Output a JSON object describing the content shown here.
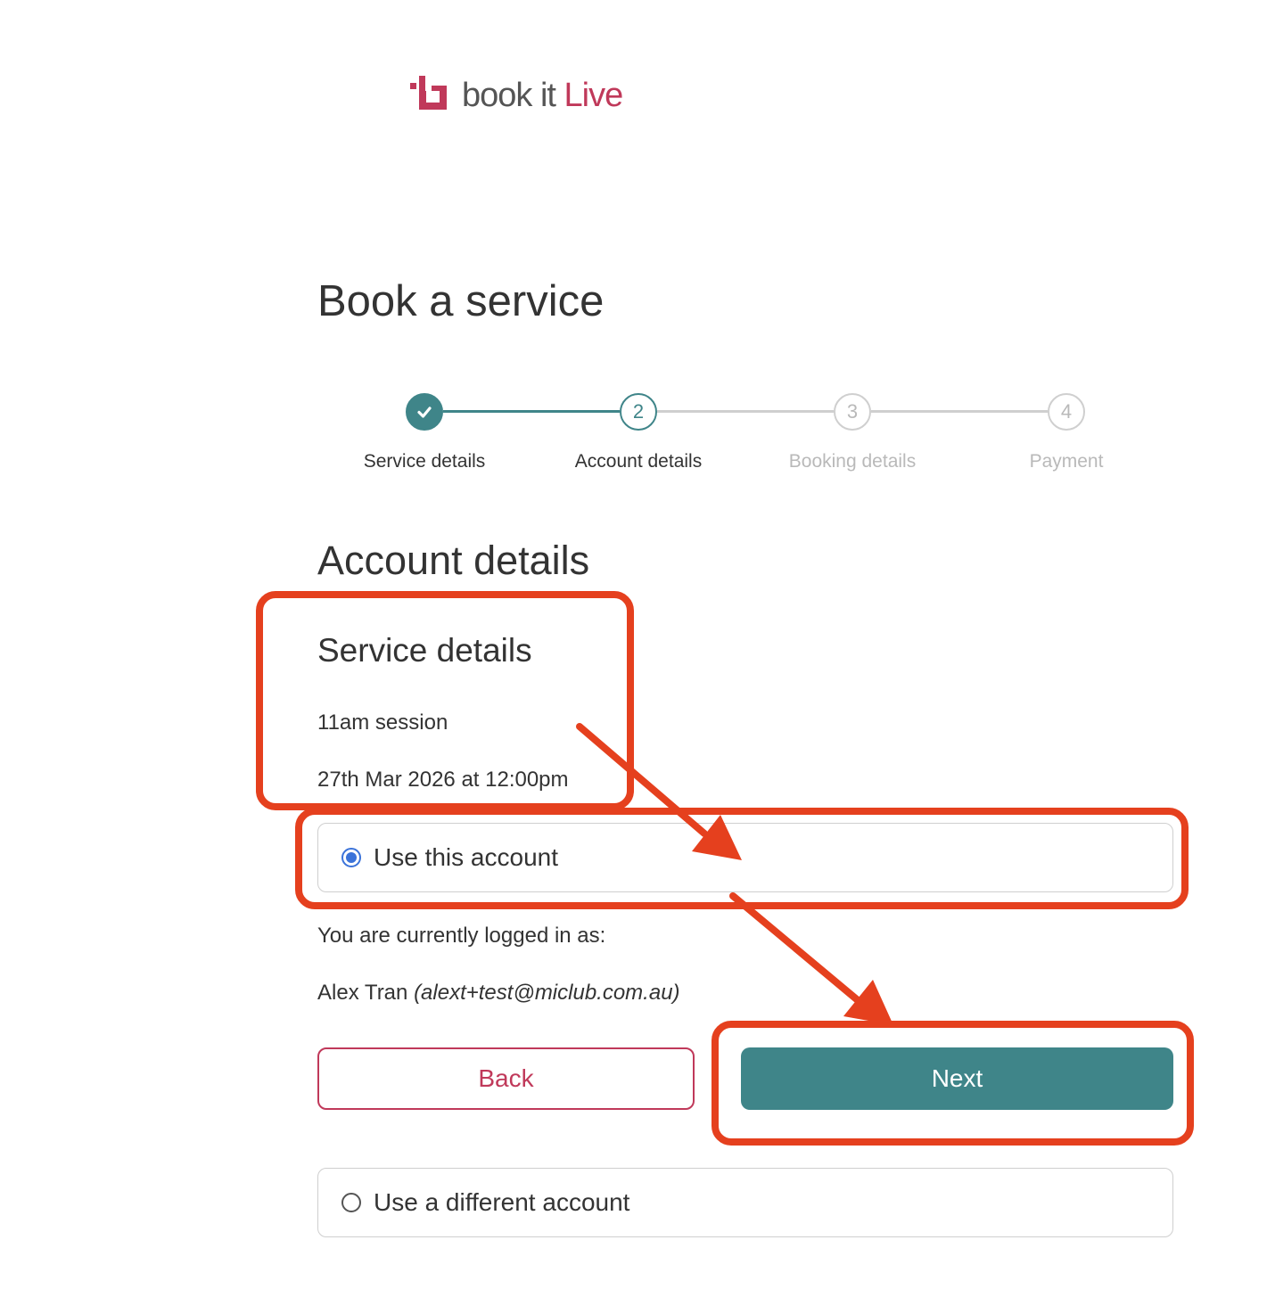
{
  "brand": {
    "logo_text_main": "book it ",
    "logo_text_accent": "Live",
    "accent_color": "#c0395a",
    "primary_color": "#3f8589"
  },
  "page": {
    "title": "Book a service"
  },
  "stepper": {
    "steps": [
      {
        "label": "Service details",
        "number": "1",
        "status": "completed",
        "icon": "check-icon"
      },
      {
        "label": "Account details",
        "number": "2",
        "status": "current"
      },
      {
        "label": "Booking details",
        "number": "3",
        "status": "pending"
      },
      {
        "label": "Payment",
        "number": "4",
        "status": "pending"
      }
    ]
  },
  "account_section": {
    "title": "Account details",
    "service_details": {
      "title": "Service details",
      "session": "11am session",
      "datetime": "27th Mar 2026 at 12:00pm"
    },
    "options": [
      {
        "label": "Use this account",
        "selected": true
      },
      {
        "label": "Use a different account",
        "selected": false
      }
    ],
    "logged_in_text": "You are currently logged in as:",
    "user_name": "Alex Tran",
    "user_email": "(alext+test@miclub.com.au)"
  },
  "buttons": {
    "back_label": "Back",
    "next_label": "Next"
  },
  "annotation_color": "#e5401e"
}
